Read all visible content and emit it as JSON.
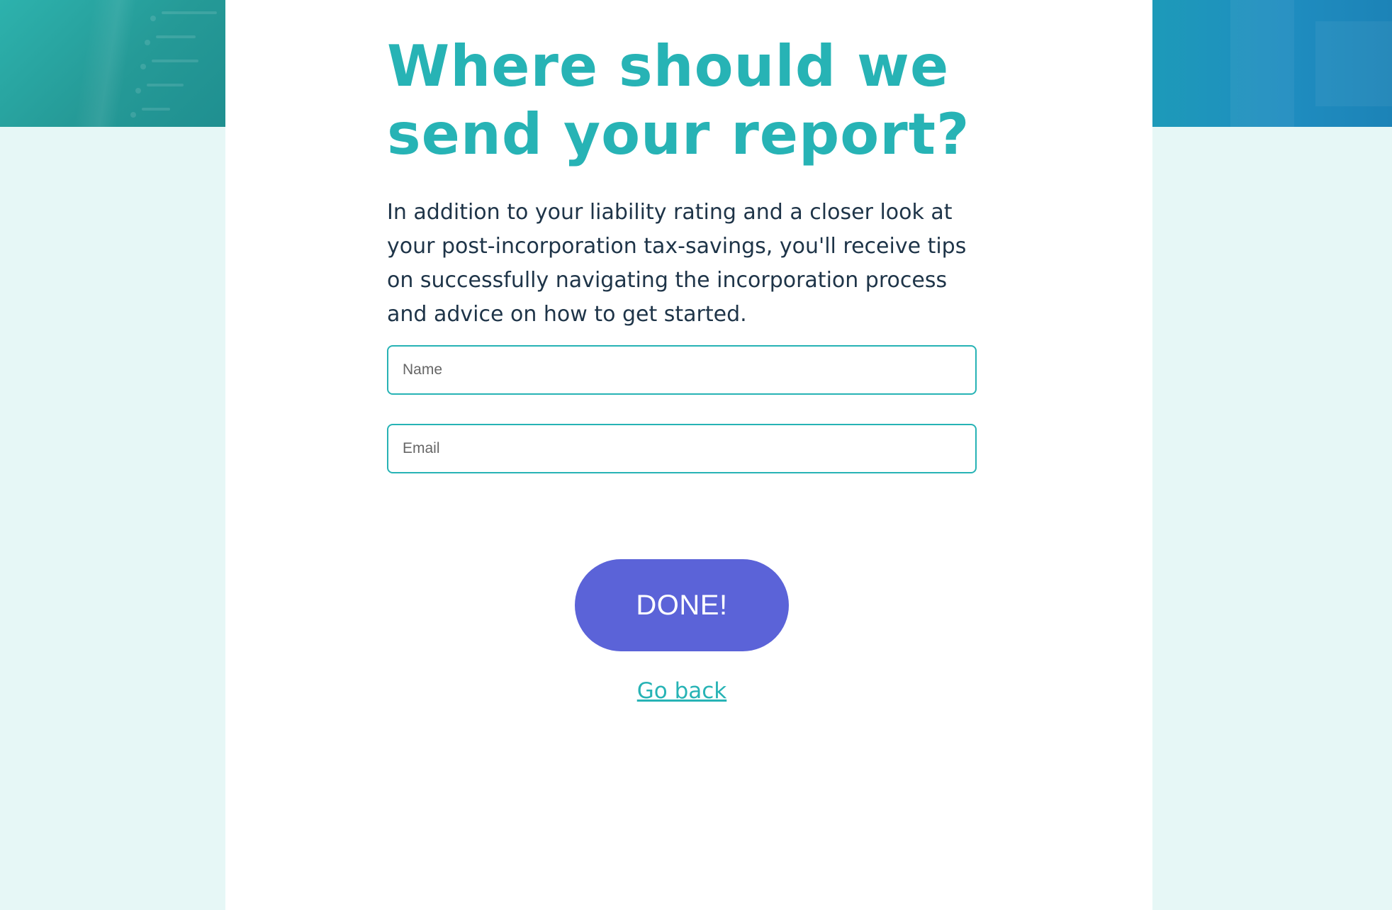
{
  "form": {
    "title": "Where should we send your report?",
    "description": "In addition to your liability rating and a closer look at your post-incorporation tax-savings, you'll receive tips on successfully navigating the incorporation process and advice on how to get started.",
    "name_field": {
      "placeholder": "Name",
      "value": ""
    },
    "email_field": {
      "placeholder": "Email",
      "value": ""
    },
    "submit_label": "DONE!",
    "back_link_label": "Go back"
  },
  "colors": {
    "page_background": "#e6f7f6",
    "card_background": "#ffffff",
    "accent_teal": "#27b3b5",
    "button_purple": "#5b63d8",
    "body_text": "#1e3448",
    "banner_left": "#259a97",
    "banner_right": "#1f8dc0"
  }
}
